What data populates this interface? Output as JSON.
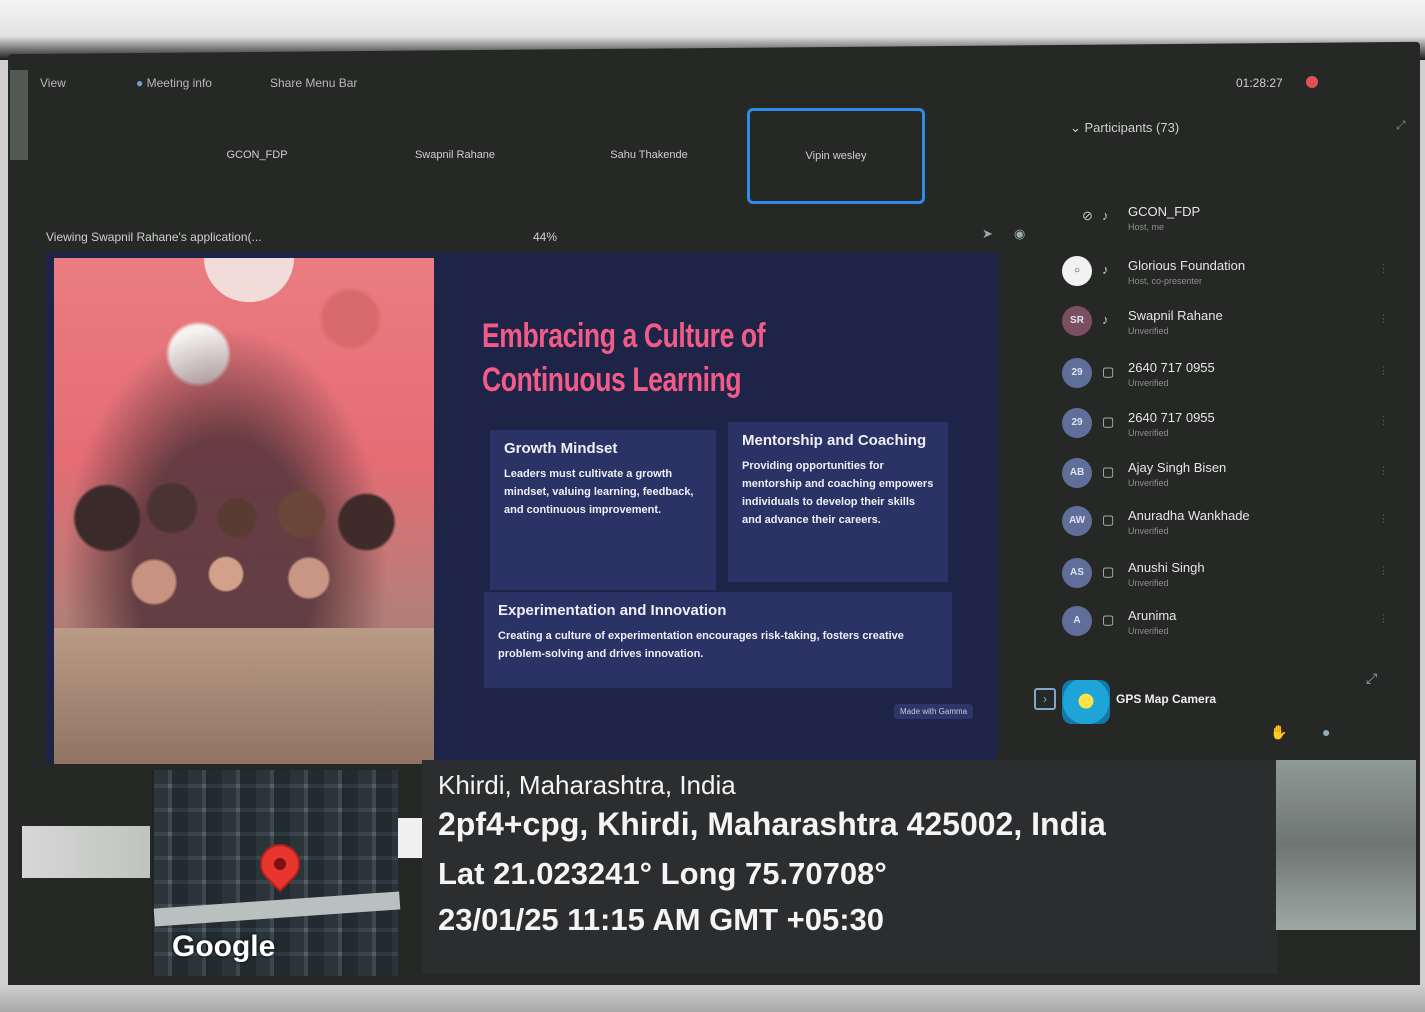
{
  "topbar": {
    "view_label": "View",
    "meeting_info": "Meeting info",
    "share_menu": "Share Menu Bar",
    "timer": "01:28:27"
  },
  "tiles": [
    "GCON_FDP",
    "Swapnil Rahane",
    "Sahu Thakende",
    "Vipin wesley"
  ],
  "viewing": {
    "label": "Viewing Swapnil Rahane's application(...",
    "zoom": "44%"
  },
  "slide": {
    "title_line1": "Embracing a Culture of",
    "title_line2": "Continuous Learning",
    "cards": [
      {
        "heading": "Growth Mindset",
        "body": "Leaders must cultivate a growth mindset, valuing learning, feedback, and continuous improvement."
      },
      {
        "heading": "Mentorship and Coaching",
        "body": "Providing opportunities for mentorship and coaching empowers individuals to develop their skills and advance their careers."
      },
      {
        "heading": "Experimentation and Innovation",
        "body": "Creating a culture of experimentation encourages risk-taking, fosters creative problem-solving and drives innovation."
      }
    ],
    "made_with": "Made with Gamma"
  },
  "participants_panel": {
    "header": "Participants (73)",
    "items": [
      {
        "initials": "",
        "name": "GCON_FDP",
        "sub": "Host, me"
      },
      {
        "initials": "",
        "name": "Glorious Foundation",
        "sub": "Host, co-presenter"
      },
      {
        "initials": "SR",
        "name": "Swapnil Rahane",
        "sub": "Unverified"
      },
      {
        "initials": "29",
        "name": "2640 717 0955",
        "sub": "Unverified"
      },
      {
        "initials": "29",
        "name": "2640 717 0955",
        "sub": "Unverified"
      },
      {
        "initials": "AB",
        "name": "Ajay Singh Bisen",
        "sub": "Unverified"
      },
      {
        "initials": "AW",
        "name": "Anuradha Wankhade",
        "sub": "Unverified"
      },
      {
        "initials": "AS",
        "name": "Anushi Singh",
        "sub": "Unverified"
      },
      {
        "initials": "A",
        "name": "Arunima",
        "sub": "Unverified"
      }
    ]
  },
  "gps": {
    "app_name": "GPS Map Camera",
    "google": "Google",
    "line1": "Khirdi, Maharashtra, India",
    "line2": "2pf4+cpg, Khirdi, Maharashtra 425002, India",
    "line3": "Lat 21.023241° Long 75.70708°",
    "line4": "23/01/25 11:15 AM GMT +05:30"
  },
  "colors": {
    "active_tile": "#2f8be6",
    "slide_title": "#f05c86",
    "slide_bg": "#1e2348",
    "card_bg": "#2a3266",
    "pin": "#e8352f"
  }
}
